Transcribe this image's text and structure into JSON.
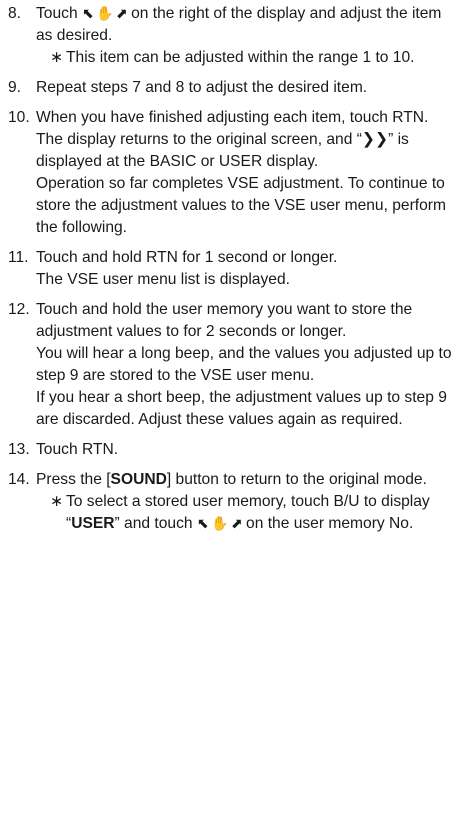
{
  "steps": [
    {
      "num": "8.",
      "lines": [
        {
          "pre": "Touch ",
          "icon": "⬉ ✋ ⬈",
          "post": " on the right of the display and adjust the item as desired."
        }
      ],
      "note": "This item can be adjusted within the range 1 to 10."
    },
    {
      "num": "9.",
      "lines": [
        {
          "text": "Repeat steps 7 and 8 to adjust the desired item."
        }
      ]
    },
    {
      "num": "10.",
      "lines": [
        {
          "text": "When you have finished adjusting each item, touch RTN."
        },
        {
          "pre": "The display returns to the original screen, and “",
          "bold": "❯❯",
          "post": "” is displayed at the BASIC or USER display."
        },
        {
          "text": "Operation so far completes VSE adjustment. To continue to store the adjustment values to the VSE user menu, perform the following."
        }
      ]
    },
    {
      "num": "11.",
      "lines": [
        {
          "text": "Touch and hold RTN for 1 second or longer."
        },
        {
          "text": "The VSE user menu list is displayed."
        }
      ]
    },
    {
      "num": "12.",
      "lines": [
        {
          "text": "Touch and hold the user memory you want to store the adjustment values to for 2 seconds or longer."
        },
        {
          "text": "You will hear a long beep, and the values you adjusted up to step 9 are stored to the VSE user menu."
        },
        {
          "text": "If you hear a short beep, the adjustment values up to step 9 are discarded. Adjust these values again as required."
        }
      ]
    },
    {
      "num": "13.",
      "lines": [
        {
          "text": "Touch RTN."
        }
      ]
    },
    {
      "num": "14.",
      "lines": [
        {
          "pre": "Press the [",
          "bold": "SOUND",
          "post": "] button to return to the original mode."
        }
      ],
      "note_rich": {
        "pre": "To select a stored user memory, touch B/U to display “",
        "bold": "USER",
        "mid": "” and touch ",
        "icon": "⬉ ✋ ⬈",
        "post": " on the user memory No."
      }
    }
  ],
  "note_mark": "∗"
}
